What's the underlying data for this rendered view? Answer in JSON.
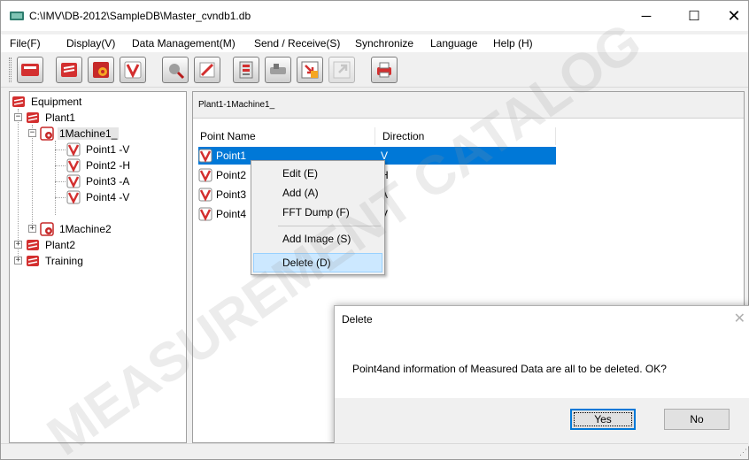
{
  "window": {
    "title": "C:\\IMV\\DB-2012\\SampleDB\\Master_cvndb1.db",
    "controls": {
      "minimize": "─",
      "maximize": "☐",
      "close": "✕"
    }
  },
  "menubar": {
    "items": [
      "File(F)",
      "Display(V)",
      "Data Management(M)",
      "Send / Receive(S)",
      "Synchronize",
      "Language",
      "Help (H)"
    ]
  },
  "toolbar": {
    "buttons": [
      {
        "icon": "open-database-icon"
      },
      {
        "icon": "equipment-icon"
      },
      {
        "icon": "machine-settings-icon"
      },
      {
        "icon": "measurement-point-icon"
      },
      {
        "icon": "search-data-icon"
      },
      {
        "icon": "pen-edit-icon"
      },
      {
        "icon": "data-transfer-icon"
      },
      {
        "icon": "sensor-icon"
      },
      {
        "icon": "import-icon"
      },
      {
        "icon": "export-icon"
      },
      {
        "icon": "print-icon"
      }
    ]
  },
  "tree": {
    "nodes": [
      {
        "label": "Equipment",
        "icon": "equipment-root-icon"
      },
      {
        "label": "Plant1",
        "icon": "plant-icon",
        "expander": "−"
      },
      {
        "label": "1Machine1_",
        "icon": "machine-icon",
        "expander": "−"
      },
      {
        "label": "Point1 -V",
        "icon": "point-icon"
      },
      {
        "label": "Point2 -H",
        "icon": "point-icon"
      },
      {
        "label": "Point3 -A",
        "icon": "point-icon"
      },
      {
        "label": "Point4 -V",
        "icon": "point-icon"
      },
      {
        "label": "1Machine2",
        "icon": "machine-icon",
        "expander": "+"
      },
      {
        "label": "Plant2",
        "icon": "plant-icon",
        "expander": "+"
      },
      {
        "label": "Training",
        "icon": "plant-icon",
        "expander": "+"
      }
    ]
  },
  "main": {
    "breadcrumb": "Plant1-1Machine1_",
    "columns": [
      "Point Name",
      "Direction"
    ],
    "rows": [
      {
        "name": "Point1",
        "direction": "V"
      },
      {
        "name": "Point2",
        "direction": "H"
      },
      {
        "name": "Point3",
        "direction": "A"
      },
      {
        "name": "Point4",
        "direction": "V"
      }
    ]
  },
  "context_menu": {
    "items": [
      "Edit (E)",
      "Add (A)",
      "FFT Dump (F)",
      "Add Image (S)",
      "Delete (D)"
    ]
  },
  "dialog": {
    "title": "Delete",
    "close": "✕",
    "message": "Point4and information of Measured Data are all to be deleted. OK?",
    "yes_label": "Yes",
    "no_label": "No"
  },
  "watermark": {
    "line1": "MEASUREMENT CATALOG"
  },
  "colors": {
    "selection": "#0078d7",
    "menu_highlight": "#cce8ff",
    "icon_red": "#d32f2f",
    "icon_blue": "#2f5fb3"
  }
}
